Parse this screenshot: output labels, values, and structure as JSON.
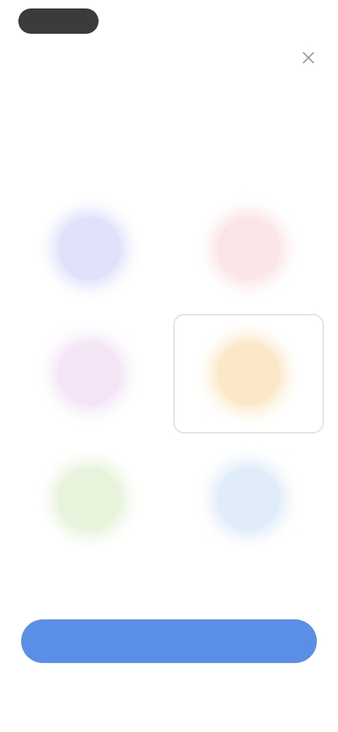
{
  "header": {
    "close_icon": "close-icon",
    "title": "",
    "subtitle": ""
  },
  "options": [
    {
      "id": "opt1",
      "label": "",
      "color": "#dcdcfb",
      "selected": false
    },
    {
      "id": "opt2",
      "label": "",
      "color": "#fbe1e3",
      "selected": false
    },
    {
      "id": "opt3",
      "label": "",
      "color": "#f1e1f5",
      "selected": false
    },
    {
      "id": "opt4",
      "label": "",
      "color": "#fbe5bf",
      "selected": true
    },
    {
      "id": "opt5",
      "label": "",
      "color": "#e4f1d7",
      "selected": false
    },
    {
      "id": "opt6",
      "label": "",
      "color": "#dbe9f8",
      "selected": false
    }
  ],
  "cta": {
    "label": "",
    "color": "#5b8ee6"
  }
}
